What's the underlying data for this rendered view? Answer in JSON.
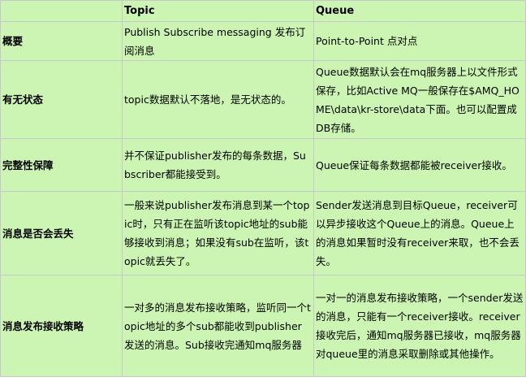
{
  "table": {
    "headers": [
      "",
      "Topic",
      "Queue"
    ],
    "rows": [
      {
        "label": "概要",
        "topic": "Publish Subscribe messaging 发布订阅消息",
        "queue": "Point-to-Point 点对点"
      },
      {
        "label": "有无状态",
        "topic": "topic数据默认不落地，是无状态的。",
        "queue": "Queue数据默认会在mq服务器上以文件形式保存，比如Active MQ一般保存在$AMQ_HOME\\data\\kr-store\\data下面。也可以配置成DB存储。"
      },
      {
        "label": "完整性保障",
        "topic": "并不保证publisher发布的每条数据，Subscriber都能接受到。",
        "queue": "Queue保证每条数据都能被receiver接收。"
      },
      {
        "label": "消息是否会丢失",
        "topic": "一般来说publisher发布消息到某一个topic时，只有正在监听该topic地址的sub能够接收到消息；如果没有sub在监听，该topic就丢失了。",
        "queue": "Sender发送消息到目标Queue，receiver可以异步接收这个Queue上的消息。Queue上的消息如果暂时没有receiver来取，也不会丢失。"
      },
      {
        "label": "消息发布接收策略",
        "topic": "一对多的消息发布接收策略，监听同一个topic地址的多个sub都能收到publisher发送的消息。Sub接收完通知mq服务器",
        "queue": "一对一的消息发布接收策略，一个sender发送的消息，只能有一个receiver接收。receiver接收完后，通知mq服务器已接收，mq服务器对queue里的消息采取删除或其他操作。"
      }
    ]
  }
}
